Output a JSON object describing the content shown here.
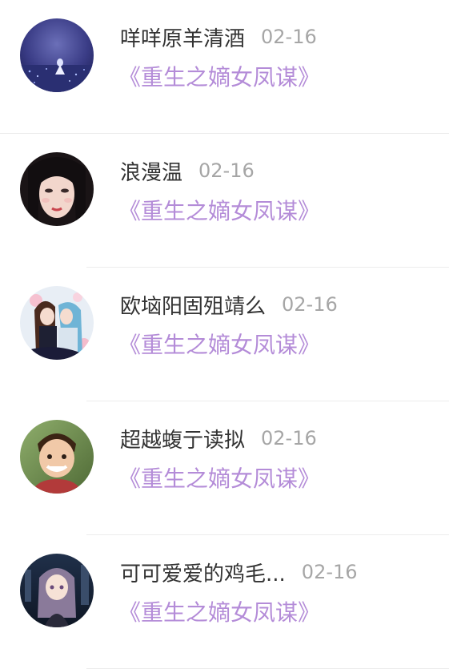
{
  "comments": [
    {
      "username": "咩咩原羊清酒",
      "date": "02-16",
      "book": "《重生之嫡女凤谋》",
      "avatar_icon": "night-field-girl-avatar"
    },
    {
      "username": "浪漫温",
      "date": "02-16",
      "book": "《重生之嫡女凤谋》",
      "avatar_icon": "dark-hair-girl-avatar"
    },
    {
      "username": "欧垴阳固殂靖么",
      "date": "02-16",
      "book": "《重生之嫡女凤谋》",
      "avatar_icon": "anime-couple-avatar"
    },
    {
      "username": "超越蝮亍读拟",
      "date": "02-16",
      "book": "《重生之嫡女凤谋》",
      "avatar_icon": "smiling-boy-avatar"
    },
    {
      "username": "可可爱爱的鸡毛...",
      "date": "02-16",
      "book": "《重生之嫡女凤谋》",
      "avatar_icon": "anime-girl-avatar"
    }
  ],
  "colors": {
    "username": "#333333",
    "date": "#a6a6a6",
    "book_link": "#b48cd8",
    "divider": "#ececec",
    "background": "#ffffff"
  }
}
